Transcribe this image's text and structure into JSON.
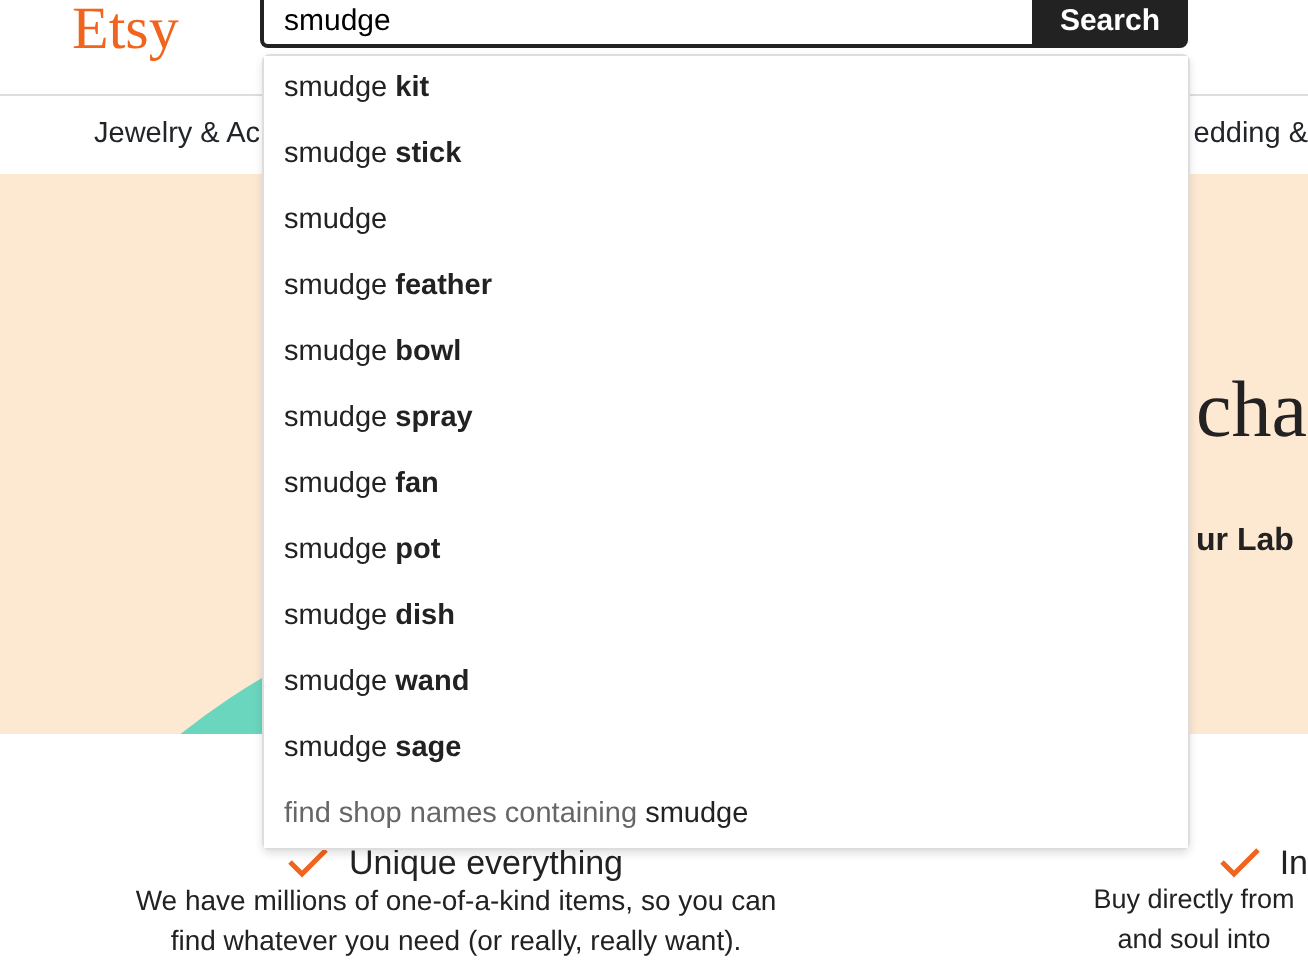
{
  "header": {
    "logo": "Etsy",
    "search": {
      "value": "smudge",
      "button": "Search"
    }
  },
  "nav": {
    "items": [
      "Jewelry & Ac",
      "edding &"
    ]
  },
  "hero": {
    "title": "cha",
    "subtitle": "ur Lab"
  },
  "features": [
    {
      "title": "Unique everything",
      "text": "We have millions of one-of-a-kind items, so you can find whatever you need (or really, really want)."
    },
    {
      "title": "In",
      "text": "Buy directly from and soul into"
    }
  ],
  "suggestions": [
    {
      "kind": "term",
      "text": "smudge **kit**"
    },
    {
      "kind": "term",
      "text": "smudge **stick**"
    },
    {
      "kind": "term",
      "text": "smudge"
    },
    {
      "kind": "term",
      "text": "smudge **feather**"
    },
    {
      "kind": "term",
      "text": "smudge **bowl**"
    },
    {
      "kind": "term",
      "text": "smudge **spray**"
    },
    {
      "kind": "term",
      "text": "smudge **fan**"
    },
    {
      "kind": "term",
      "text": "smudge **pot**"
    },
    {
      "kind": "term",
      "text": "smudge **dish**"
    },
    {
      "kind": "term",
      "text": "smudge **wand**"
    },
    {
      "kind": "term",
      "text": "smudge **sage**"
    },
    {
      "kind": "shop",
      "text": "find shop names containing",
      "term": "smudge"
    }
  ]
}
